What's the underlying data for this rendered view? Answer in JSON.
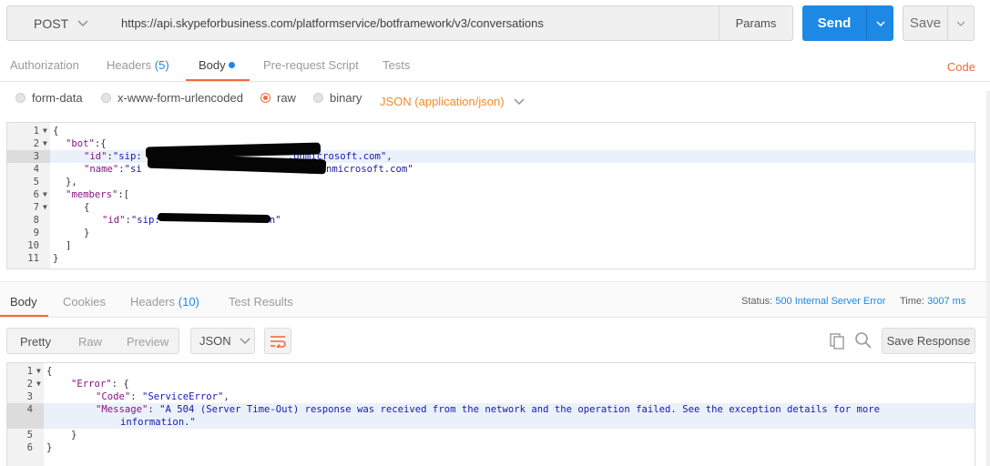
{
  "request": {
    "method": "POST",
    "url": "https://api.skypeforbusiness.com/platformservice/botframework/v3/conversations",
    "params_label": "Params",
    "send_label": "Send",
    "save_label": "Save"
  },
  "request_tabs": {
    "authorization": "Authorization",
    "headers": "Headers",
    "headers_count": "(5)",
    "body": "Body",
    "prerequest": "Pre-request Script",
    "tests": "Tests",
    "code": "Code"
  },
  "body_types": {
    "form_data": "form-data",
    "urlencoded": "x-www-form-urlencoded",
    "raw": "raw",
    "binary": "binary",
    "selected": "raw",
    "content_type": "JSON (application/json)"
  },
  "request_body": {
    "lines": [
      {
        "n": "1",
        "fold": true
      },
      {
        "n": "2",
        "fold": true
      },
      {
        "n": "3",
        "fold": false
      },
      {
        "n": "4",
        "fold": false
      },
      {
        "n": "5",
        "fold": false
      },
      {
        "n": "6",
        "fold": true
      },
      {
        "n": "7",
        "fold": true
      },
      {
        "n": "8",
        "fold": false
      },
      {
        "n": "9",
        "fold": false
      },
      {
        "n": "10",
        "fold": false
      },
      {
        "n": "11",
        "fold": false
      }
    ],
    "l1": "{",
    "l2_key": "\"bot\"",
    "l2_rest": ":{",
    "l3_key": "\"id\"",
    "l3_val_a": "\"sip:",
    "l3_val_b": ".onmicrosoft.com\"",
    "l3_end": ",",
    "l4_key": "\"name\"",
    "l4_val_a": "\"si",
    "l4_val_b": "y.onmicrosoft.com\"",
    "l5": "},",
    "l6_key": "\"members\"",
    "l6_rest": ":[",
    "l7": "{",
    "l8_key": "\"id\"",
    "l8_val_a": "\"sip:",
    "l8_val_b": "n\"",
    "l9": "}",
    "l10": "]",
    "l11": "}"
  },
  "response_tabs": {
    "body": "Body",
    "cookies": "Cookies",
    "headers": "Headers",
    "headers_count": "(10)",
    "test_results": "Test Results",
    "status_label": "Status:",
    "status_value": "500 Internal Server Error",
    "time_label": "Time:",
    "time_value": "3007 ms"
  },
  "response_toolbar": {
    "pretty": "Pretty",
    "raw": "Raw",
    "preview": "Preview",
    "format": "JSON",
    "save_response": "Save Response"
  },
  "response_body": {
    "lines": [
      {
        "n": "1",
        "fold": true
      },
      {
        "n": "2",
        "fold": true
      },
      {
        "n": "3",
        "fold": false
      },
      {
        "n": "4",
        "fold": false
      },
      {
        "n": "",
        "fold": false
      },
      {
        "n": "5",
        "fold": false
      },
      {
        "n": "6",
        "fold": false
      }
    ],
    "l1": "{",
    "l2_key": "\"Error\"",
    "l2_rest": ": {",
    "l3_key": "\"Code\"",
    "l3_sep": ": ",
    "l3_val": "\"ServiceError\"",
    "l3_end": ",",
    "l4_key": "\"Message\"",
    "l4_sep": ": ",
    "l4_val": "\"A 504 (Server Time-Out) response was received from the network and the operation failed. See the exception details for more",
    "l4_cont": "information.\"",
    "l5": "}",
    "l6": "}"
  },
  "colors": {
    "accent_blue": "#1e88e5",
    "accent_orange": "#f26b3a",
    "json_key": "#881280",
    "json_string": "#1a1aa6"
  }
}
